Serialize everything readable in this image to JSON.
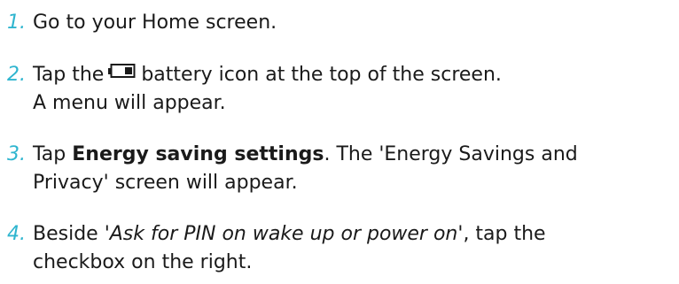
{
  "steps": [
    {
      "number": "1.",
      "text": "Go to your Home screen."
    },
    {
      "number": "2.",
      "before_icon": "Tap the",
      "icon": "battery-icon",
      "after_icon": "battery icon at the top of the screen.",
      "line2": "A menu will appear."
    },
    {
      "number": "3.",
      "prefix": "Tap ",
      "bold": "Energy saving settings",
      "suffix": ". The 'Energy Savings and",
      "line2": "Privacy' screen will appear."
    },
    {
      "number": "4.",
      "prefix": "Beside '",
      "italic": "Ask for PIN on wake up or power on",
      "suffix": "', tap the",
      "line2": "checkbox on the right."
    }
  ],
  "colors": {
    "step_number": "#2fb5cf",
    "text": "#1a1a1a"
  }
}
